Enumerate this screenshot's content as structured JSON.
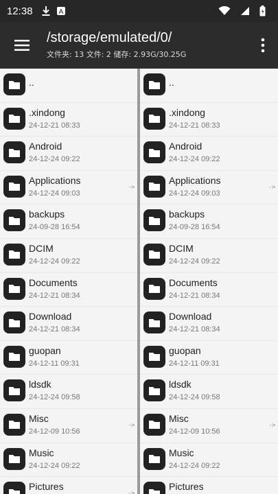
{
  "status_bar": {
    "time": "12:38",
    "left_icons": [
      "download-icon",
      "text-notification-icon"
    ],
    "right_icons": [
      "wifi-icon",
      "signal-icon",
      "battery-icon"
    ]
  },
  "app_bar": {
    "path": "/storage/emulated/0/",
    "subtitle": "文件夹: 13  文件: 2  储存: 2.93G/30.25G",
    "menu_icon": "hamburger-menu-icon",
    "overflow_icon": "more-vert-icon"
  },
  "left_pane": {
    "items": [
      {
        "name": "..",
        "date": "",
        "arrow": ""
      },
      {
        "name": ".xindong",
        "date": "24-12-21 08:33",
        "arrow": ""
      },
      {
        "name": "Android",
        "date": "24-12-24 09:22",
        "arrow": ""
      },
      {
        "name": "Applications",
        "date": "24-12-24 09:03",
        "arrow": "->"
      },
      {
        "name": "backups",
        "date": "24-09-28 16:54",
        "arrow": ""
      },
      {
        "name": "DCIM",
        "date": "24-12-24 09:22",
        "arrow": ""
      },
      {
        "name": "Documents",
        "date": "24-12-21 08:34",
        "arrow": ""
      },
      {
        "name": "Download",
        "date": "24-12-21 08:34",
        "arrow": ""
      },
      {
        "name": "guopan",
        "date": "24-12-11 09:31",
        "arrow": ""
      },
      {
        "name": "ldsdk",
        "date": "24-12-24 09:58",
        "arrow": ""
      },
      {
        "name": "Misc",
        "date": "24-12-09 10:56",
        "arrow": "->"
      },
      {
        "name": "Music",
        "date": "24-12-24 09:22",
        "arrow": ""
      },
      {
        "name": "Pictures",
        "date": "",
        "arrow": "->"
      }
    ]
  },
  "right_pane": {
    "items": [
      {
        "name": "..",
        "date": "",
        "arrow": ""
      },
      {
        "name": ".xindong",
        "date": "24-12-21 08:33",
        "arrow": ""
      },
      {
        "name": "Android",
        "date": "24-12-24 09:22",
        "arrow": ""
      },
      {
        "name": "Applications",
        "date": "24-12-24 09:03",
        "arrow": "->"
      },
      {
        "name": "backups",
        "date": "24-09-28 16:54",
        "arrow": ""
      },
      {
        "name": "DCIM",
        "date": "24-12-24 09:22",
        "arrow": ""
      },
      {
        "name": "Documents",
        "date": "24-12-21 08:34",
        "arrow": ""
      },
      {
        "name": "Download",
        "date": "24-12-21 08:34",
        "arrow": ""
      },
      {
        "name": "guopan",
        "date": "24-12-11 09:31",
        "arrow": ""
      },
      {
        "name": "ldsdk",
        "date": "24-12-24 09:58",
        "arrow": ""
      },
      {
        "name": "Misc",
        "date": "24-12-09 10:56",
        "arrow": "->"
      },
      {
        "name": "Music",
        "date": "24-12-24 09:22",
        "arrow": ""
      },
      {
        "name": "Pictures",
        "date": "",
        "arrow": ""
      }
    ]
  },
  "colors": {
    "status_bar_bg": "#262626",
    "app_bar_bg": "#2c2c2c",
    "pane_bg": "#f4f4f4",
    "folder_icon_bg": "#222222",
    "divider": "#9a9a9a"
  }
}
